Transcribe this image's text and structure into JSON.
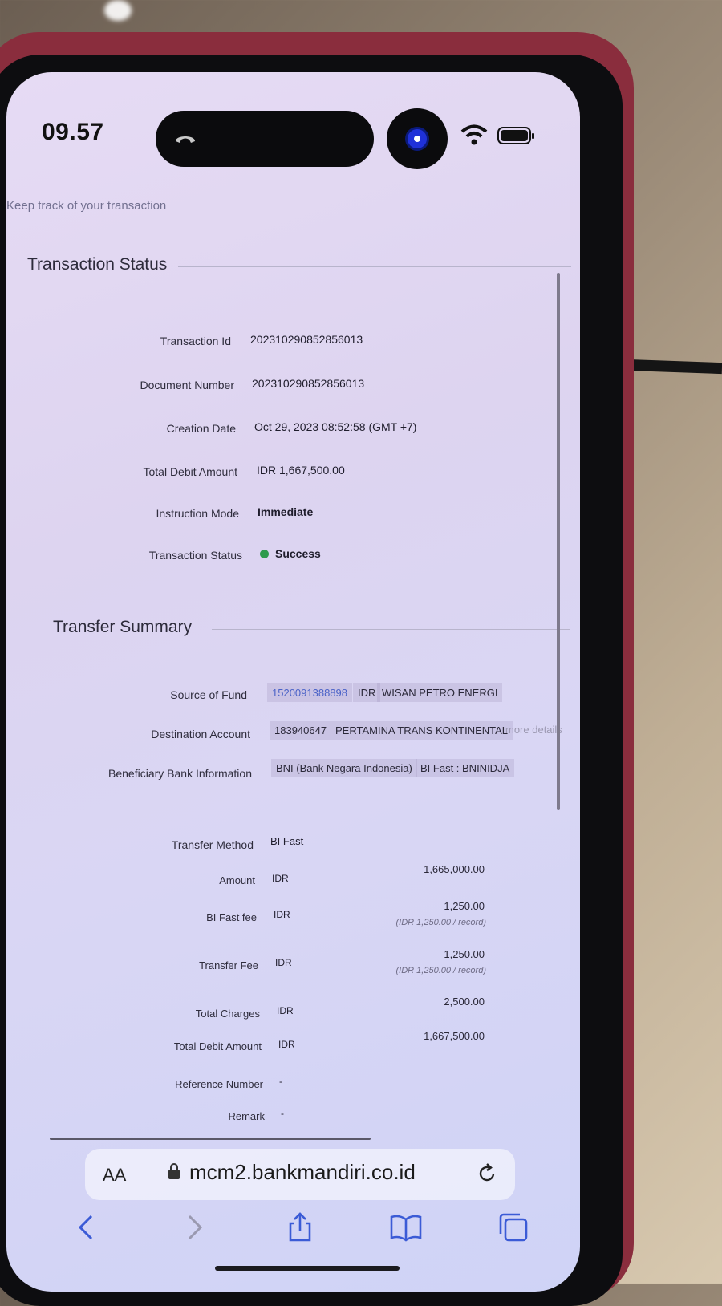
{
  "status_bar": {
    "time": "09.57"
  },
  "page": {
    "subtitle": "Keep track of your transaction",
    "transaction_status": {
      "title": "Transaction Status",
      "rows": [
        {
          "label": "Transaction Id",
          "value": "202310290852856013"
        },
        {
          "label": "Document Number",
          "value": "202310290852856013"
        },
        {
          "label": "Creation Date",
          "value": "Oct 29, 2023 08:52:58 (GMT +7)"
        },
        {
          "label": "Total Debit Amount",
          "value": "IDR 1,667,500.00"
        },
        {
          "label": "Instruction Mode",
          "value": "Immediate"
        },
        {
          "label": "Transaction Status",
          "value": "Success"
        }
      ],
      "status_color": "#2e9a4d"
    },
    "transfer_summary": {
      "title": "Transfer Summary",
      "source_of_fund": {
        "label": "Source of Fund",
        "account": "1520091388898",
        "currency": "IDR",
        "name": "WISAN PETRO ENERGI"
      },
      "destination_account": {
        "label": "Destination Account",
        "account": "183940647",
        "name": "PERTAMINA TRANS KONTINENTAL",
        "more": "more details"
      },
      "beneficiary_bank": {
        "label": "Beneficiary Bank Information",
        "bank": "BNI (Bank Negara Indonesia)",
        "code": "BI Fast : BNINIDJA"
      },
      "transfer_method": {
        "label": "Transfer Method",
        "value": "BI Fast"
      },
      "amount": {
        "label": "Amount",
        "currency": "IDR",
        "value": "1,665,000.00"
      },
      "bi_fast_fee": {
        "label": "BI Fast fee",
        "currency": "IDR",
        "value": "1,250.00",
        "note": "(IDR 1,250.00 / record)"
      },
      "transfer_fee": {
        "label": "Transfer Fee",
        "currency": "IDR",
        "value": "1,250.00",
        "note": "(IDR 1,250.00 / record)"
      },
      "total_charges": {
        "label": "Total Charges",
        "currency": "IDR",
        "value": "2,500.00"
      },
      "total_debit": {
        "label": "Total Debit Amount",
        "currency": "IDR",
        "value": "1,667,500.00"
      },
      "reference_number": {
        "label": "Reference Number",
        "value": "-"
      },
      "remark": {
        "label": "Remark",
        "value": "-"
      }
    }
  },
  "browser": {
    "text_size_label": "AA",
    "url": "mcm2.bankmandiri.co.id"
  },
  "colors": {
    "link": "#4b63c8",
    "case": "#8a2d3d"
  }
}
